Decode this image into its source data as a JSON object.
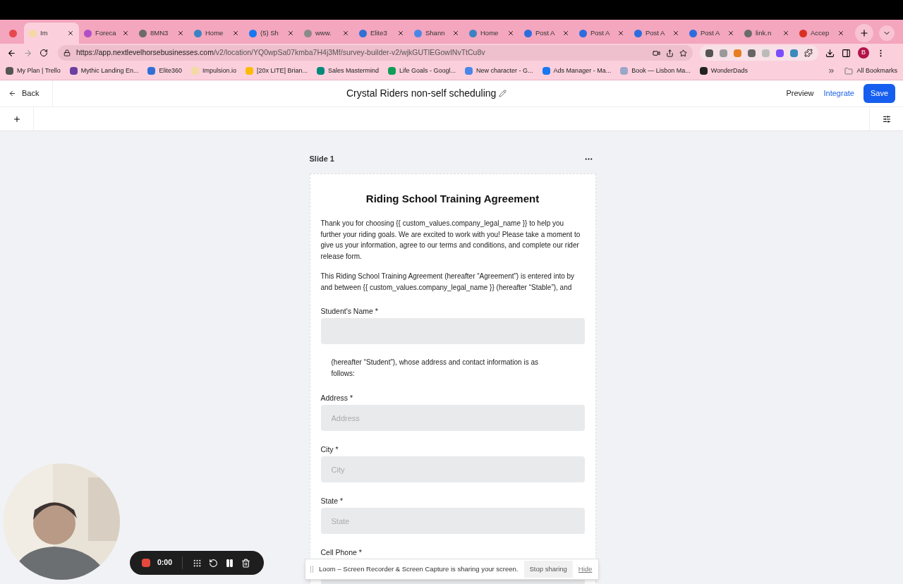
{
  "browser": {
    "tabs": [
      {
        "selected": false,
        "color": "#e5484d"
      },
      {
        "title": "Im",
        "selected": true,
        "color": "#f3d9a4"
      },
      {
        "title": "Foreca",
        "selected": false,
        "color": "#b04fc8"
      },
      {
        "title": "8MN3",
        "selected": false,
        "color": "#6b6b6b"
      },
      {
        "title": "Home",
        "selected": false,
        "color": "#3b82c4"
      },
      {
        "title": "(5) Sh",
        "selected": false,
        "color": "#1877f2"
      },
      {
        "title": "www.",
        "selected": false,
        "color": "#8a8a8a"
      },
      {
        "title": "Elite3",
        "selected": false,
        "color": "#2f6fd6"
      },
      {
        "title": "Shann",
        "selected": false,
        "color": "#4a86e8"
      },
      {
        "title": "Home",
        "selected": false,
        "color": "#3b82c4"
      },
      {
        "title": "Post A",
        "selected": false,
        "color": "#2d6cdf"
      },
      {
        "title": "Post A",
        "selected": false,
        "color": "#2d6cdf"
      },
      {
        "title": "Post A",
        "selected": false,
        "color": "#2d6cdf"
      },
      {
        "title": "Post A",
        "selected": false,
        "color": "#2d6cdf"
      },
      {
        "title": "link.n",
        "selected": false,
        "color": "#6b6b6b"
      },
      {
        "title": "Accep",
        "selected": false,
        "color": "#d93025"
      }
    ],
    "url_host": "https://app.nextlevelhorsebusinesses.com",
    "url_path": "/v2/location/YQ0wpSa07kmba7H4j3Mf/survey-builder-v2/wjkGUTIEGowINvTtCu8v",
    "profile_initial": "B",
    "bookmarks": [
      {
        "title": "My Plan | Trello",
        "color": "#555555"
      },
      {
        "title": "Mythic Landing En...",
        "color": "#6a3fa0"
      },
      {
        "title": "Elite360",
        "color": "#2f6fd6"
      },
      {
        "title": "Impulsion.io",
        "color": "#f3d9a4"
      },
      {
        "title": "[20x LITE] Brian...",
        "color": "#fbbc04"
      },
      {
        "title": "Sales Mastermind",
        "color": "#00897b"
      },
      {
        "title": "Life Goals - Googl...",
        "color": "#0f9d58"
      },
      {
        "title": "New character - G...",
        "color": "#4a86e8"
      },
      {
        "title": "Ads Manager - Ma...",
        "color": "#1877f2"
      },
      {
        "title": "Book — Lisbon Ma...",
        "color": "#9aa7c7"
      },
      {
        "title": "WonderDads",
        "color": "#222222"
      }
    ],
    "all_bookmarks": "All Bookmarks"
  },
  "header": {
    "back": "Back",
    "title": "Crystal Riders non-self scheduling",
    "preview": "Preview",
    "integrate": "Integrate",
    "save": "Save"
  },
  "slide": {
    "label": "Slide 1",
    "heading": "Riding School Training Agreement",
    "intro": "Thank you for choosing {{ custom_values.company_legal_name }} to help you further your riding goals. We are excited to work with you! Please take a moment to give us your information, agree to our terms and conditions, and complete our rider release form.",
    "agreement": "This Riding School Training Agreement (hereafter “Agreement”) is entered into by and between {{ custom_values.company_legal_name }} (hereafter “Stable”),  and",
    "fields": [
      {
        "kind": "field",
        "label": "Student's Name",
        "required_mark": "*"
      },
      {
        "kind": "text",
        "text": "(hereafter “Student”), whose address and contact information is as follows:"
      },
      {
        "kind": "field",
        "label": "Address",
        "required_mark": "*",
        "placeholder": "Address"
      },
      {
        "kind": "field",
        "label": "City",
        "required_mark": "*",
        "placeholder": "City"
      },
      {
        "kind": "field",
        "label": "State",
        "required_mark": "*",
        "placeholder": "State"
      },
      {
        "kind": "field",
        "label": "Cell Phone",
        "required_mark": "*"
      }
    ]
  },
  "recorder": {
    "time": "0:00"
  },
  "sharing_bar": {
    "message": "Loom – Screen Recorder & Screen Capture is sharing your screen.",
    "stop": "Stop sharing",
    "hide": "Hide"
  }
}
